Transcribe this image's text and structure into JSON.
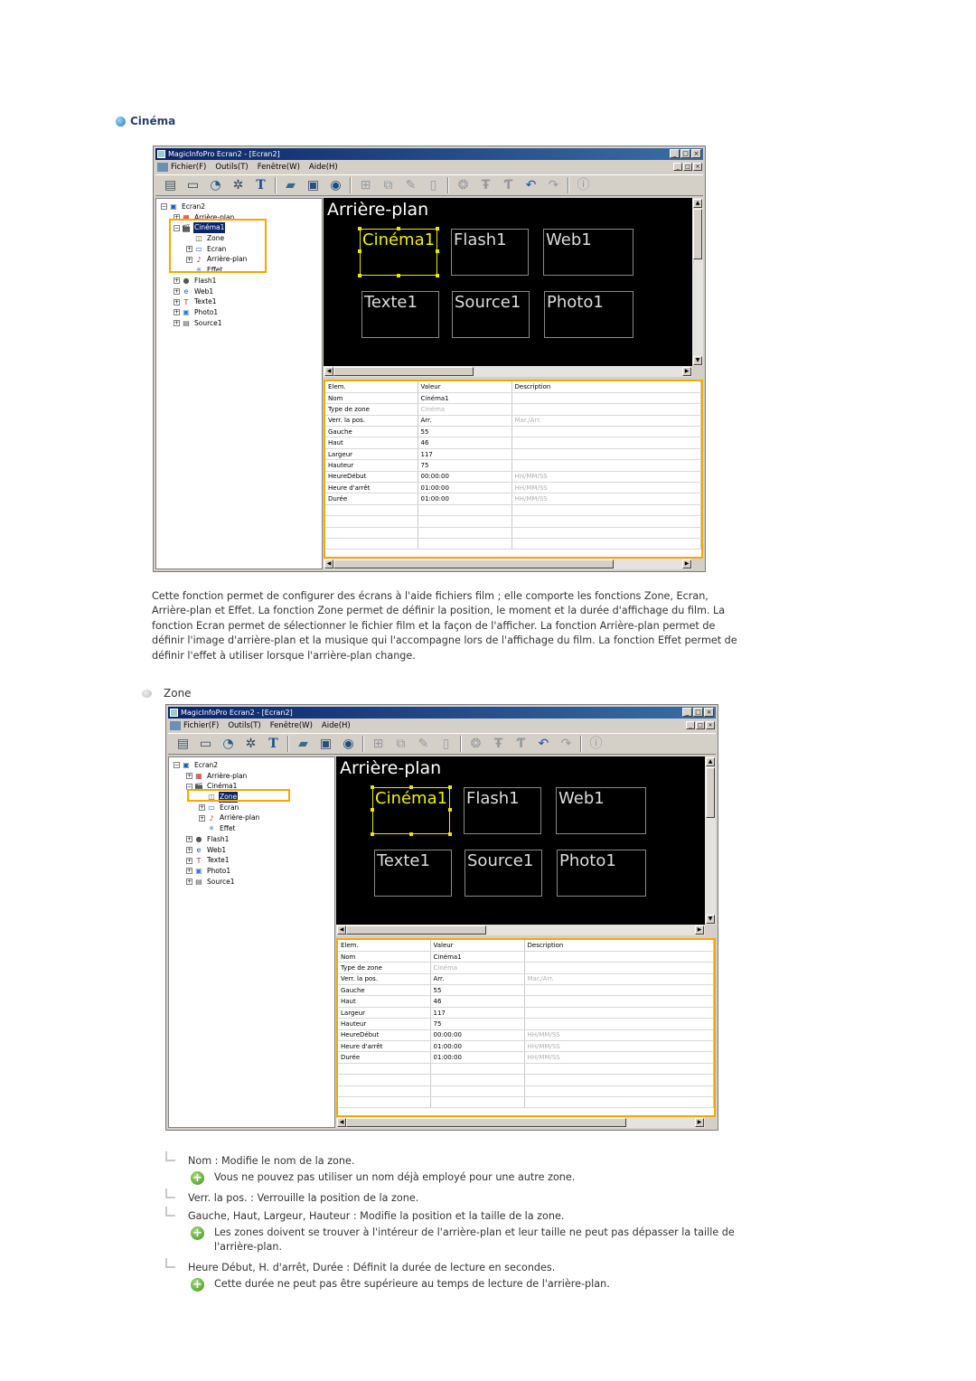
{
  "section_title": "Cinéma",
  "description": "Cette fonction permet de configurer des écrans à l'aide fichiers film ; elle comporte les fonctions Zone, Ecran, Arrière-plan et Effet. La fonction Zone permet de définir la position, le moment et la durée d'affichage du film. La fonction Ecran permet de sélectionner le fichier film et la façon de l'afficher. La fonction Arrière-plan permet de définir l'image d'arrière-plan et la musique qui l'accompagne lors de l'affichage du film. La fonction Effet permet de définir l'effet à utiliser lorsque l'arrière-plan change.",
  "subsection_title": "Zone",
  "window": {
    "title": "MagicInfoPro Ecran2 - [Ecran2]",
    "menus": [
      "Fichier(F)",
      "Outils(T)",
      "Fenêtre(W)",
      "Aide(H)"
    ],
    "win_controls": [
      "_",
      "□",
      "×"
    ],
    "toolbar_icons": [
      "new-icon",
      "monitor-icon",
      "clock-icon",
      "settings-icon",
      "text-icon",
      "folder-icon",
      "save-icon",
      "preview-icon",
      "add-zone-icon",
      "copy-zone-icon",
      "paste-icon",
      "delete-icon",
      "network-icon",
      "font-icon",
      "font-size-icon",
      "undo-icon",
      "redo-icon",
      "info-icon"
    ],
    "tree": [
      {
        "label": "Ecran2",
        "level": 0,
        "exp": "−",
        "icon": "▣"
      },
      {
        "label": "Arrière-plan",
        "level": 1,
        "exp": "+",
        "icon": "▦"
      },
      {
        "label": "Cinéma1",
        "level": 1,
        "exp": "−",
        "icon": "🎬"
      },
      {
        "label": "Zone",
        "level": 2,
        "exp": "",
        "icon": "◫"
      },
      {
        "label": "Ecran",
        "level": 2,
        "exp": "+",
        "icon": "▭"
      },
      {
        "label": "Arrière-plan",
        "level": 2,
        "exp": "+",
        "icon": "♪"
      },
      {
        "label": "Effet",
        "level": 2,
        "exp": "",
        "icon": "✳"
      },
      {
        "label": "Flash1",
        "level": 1,
        "exp": "+",
        "icon": "●"
      },
      {
        "label": "Web1",
        "level": 1,
        "exp": "+",
        "icon": "e"
      },
      {
        "label": "Texte1",
        "level": 1,
        "exp": "+",
        "icon": "T"
      },
      {
        "label": "Photo1",
        "level": 1,
        "exp": "+",
        "icon": "▣"
      },
      {
        "label": "Source1",
        "level": 1,
        "exp": "+",
        "icon": "▤"
      }
    ],
    "canvas_label": "Arrière-plan",
    "zones": [
      "Cinéma1",
      "Flash1",
      "Web1",
      "Texte1",
      "Source1",
      "Photo1"
    ],
    "prop_headers": [
      "Elem.",
      "Valeur",
      "Description"
    ],
    "props": [
      {
        "elem": "Nom",
        "valeur": "Cinéma1",
        "desc": ""
      },
      {
        "elem": "Type de zone",
        "valeur": "Cinéma",
        "desc": ""
      },
      {
        "elem": "Verr. la pos.",
        "valeur": "Arr.",
        "desc": "Mar./Arr."
      },
      {
        "elem": "Gauche",
        "valeur": "55",
        "desc": ""
      },
      {
        "elem": "Haut",
        "valeur": "46",
        "desc": ""
      },
      {
        "elem": "Largeur",
        "valeur": "117",
        "desc": ""
      },
      {
        "elem": "Hauteur",
        "valeur": "75",
        "desc": ""
      },
      {
        "elem": "HeureDébut",
        "valeur": "00:00:00",
        "desc": "HH/MM/SS"
      },
      {
        "elem": "Heure d'arrêt",
        "valeur": "01:00:00",
        "desc": "HH/MM/SS"
      },
      {
        "elem": "Durée",
        "valeur": "01:00:00",
        "desc": "HH/MM/SS"
      }
    ]
  },
  "notes": [
    {
      "text": "Nom : Modifie le nom de la zone.",
      "tips": [
        "Vous ne pouvez pas utiliser un nom déjà employé pour une autre zone."
      ]
    },
    {
      "text": "Verr. la pos. : Verrouille la position de la zone.",
      "tips": []
    },
    {
      "text": "Gauche, Haut, Largeur, Hauteur : Modifie la position et la taille de la zone.",
      "tips": [
        "Les zones doivent se trouver à l'intéreur de l'arrière-plan et leur taille ne peut pas dépasser la taille de l'arrière-plan."
      ]
    },
    {
      "text": "Heure Début, H. d'arrêt, Durée : Définit la durée de lecture en secondes.",
      "tips": [
        "Cette durée ne peut pas être supérieure au temps de lecture de l'arrière-plan."
      ]
    }
  ]
}
